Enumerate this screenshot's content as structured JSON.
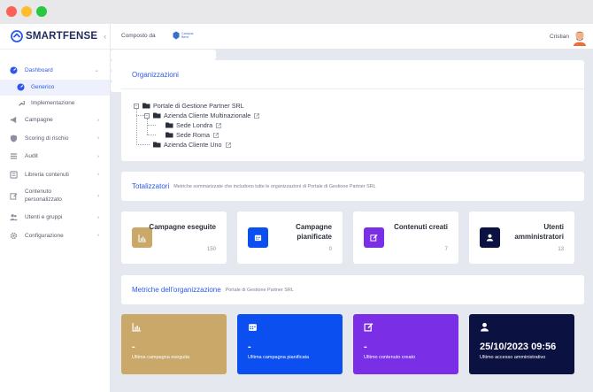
{
  "app": {
    "brand": "SMARTFENSE"
  },
  "sidebar": {
    "items": [
      {
        "label": "Dashboard",
        "icon": "dashboard-icon",
        "active": true
      },
      {
        "label": "Campagne",
        "icon": "megaphone-icon"
      },
      {
        "label": "Scoring di rischio",
        "icon": "shield-icon"
      },
      {
        "label": "Audit",
        "icon": "list-icon"
      },
      {
        "label": "Libreria contenuti",
        "icon": "library-icon"
      },
      {
        "label": "Contenuto personalizzato",
        "icon": "edit-icon"
      },
      {
        "label": "Utenti e gruppi",
        "icon": "users-icon"
      },
      {
        "label": "Configurazione",
        "icon": "gear-icon"
      }
    ],
    "subitems": [
      {
        "label": "Generico",
        "icon": "dashboard-icon",
        "active": true
      },
      {
        "label": "Implementazione",
        "icon": "wrench-icon"
      }
    ]
  },
  "topbar": {
    "composed_by": "Composto da",
    "partner_logo_text": [
      "Campus",
      "Bene"
    ],
    "user_name": "Cristian"
  },
  "organizations": {
    "title": "Organizzazioni",
    "tree": {
      "root": "Portale di Gestione Partner SRL",
      "child1": "Azienda Cliente Multinazionale",
      "grandchild1": "Sede Londra",
      "grandchild2": "Sede Roma",
      "child2": "Azienda Cliente Uno"
    }
  },
  "totals": {
    "title": "Totalizzatori",
    "subtitle": "Metriche sommarizzate che includono tutte le organizzazioni di Portale di Gestione Partner SRL",
    "cards": [
      {
        "label": "Campagne eseguite",
        "value": "150",
        "icon": "chart-icon",
        "color": "#c9a86a"
      },
      {
        "label": "Campagne pianificate",
        "value": "0",
        "icon": "calendar-icon",
        "color": "#0b4ff0"
      },
      {
        "label": "Contenuti creati",
        "value": "7",
        "icon": "edit-icon",
        "color": "#7a2ee6"
      },
      {
        "label": "Utenti amministratori",
        "value": "13",
        "icon": "user-icon",
        "color": "#0b1140"
      }
    ]
  },
  "metrics": {
    "title": "Metriche dell'organizzazione",
    "subtitle": "Portale di Gestione Partner SRL",
    "cards": [
      {
        "value": "-",
        "label": "Ultima campagna eseguita",
        "icon": "chart-icon",
        "color": "#c9a86a"
      },
      {
        "value": "-",
        "label": "Ultima campagna pianificata",
        "icon": "calendar-icon",
        "color": "#0b4ff0"
      },
      {
        "value": "-",
        "label": "Ultimo contenuto creato",
        "icon": "edit-icon",
        "color": "#7a2ee6"
      },
      {
        "value": "25/10/2023 09:56",
        "label": "Ultimo accesso amministrativo",
        "icon": "user-icon",
        "color": "#0b1140"
      }
    ]
  }
}
